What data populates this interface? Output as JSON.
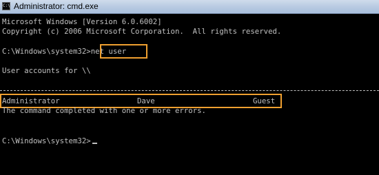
{
  "window": {
    "title": "Administrator: cmd.exe",
    "icon": "cmd-icon"
  },
  "console": {
    "version_line": "Microsoft Windows [Version 6.0.6002]",
    "copyright_line": "Copyright (c) 2006 Microsoft Corporation.  All rights reserved.",
    "prompt_1": "C:\\Windows\\system32>",
    "command_1": "net user",
    "accounts_header": "User accounts for \\\\",
    "accounts": [
      "Administrator",
      "Dave",
      "Guest"
    ],
    "completion_message": "The command completed with one or more errors.",
    "prompt_2": "C:\\Windows\\system32>"
  },
  "colors": {
    "console_background": "#000000",
    "console_text": "#c0c0c0",
    "highlight_border": "#f0a030"
  }
}
